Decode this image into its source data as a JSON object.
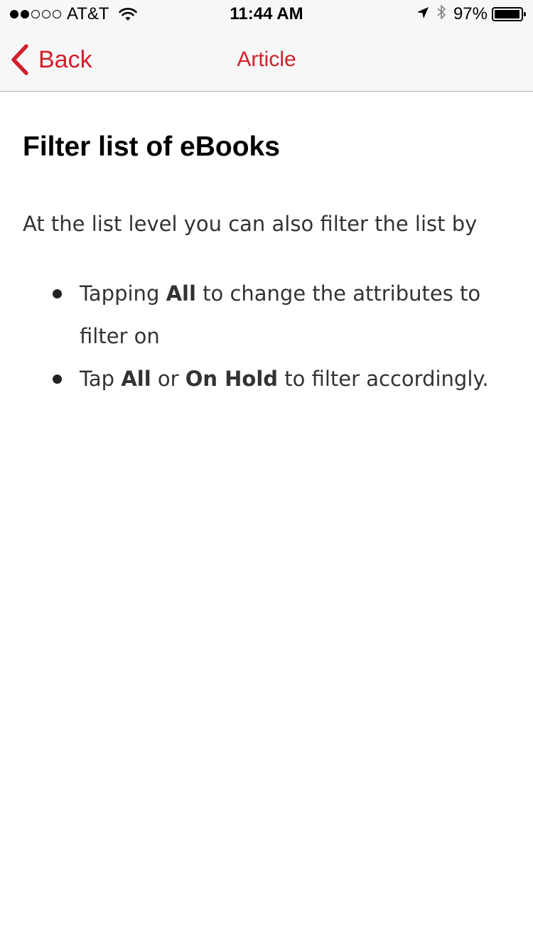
{
  "status_bar": {
    "carrier": "AT&T",
    "signal_bars_filled": 2,
    "signal_bars_total": 5,
    "time": "11:44 AM",
    "battery_percent": "97%",
    "battery_level": 0.97,
    "icons": [
      "wifi-icon",
      "location-icon",
      "bluetooth-icon",
      "battery-icon"
    ]
  },
  "nav": {
    "back_label": "Back",
    "title": "Article",
    "accent_color": "#d0202b"
  },
  "article": {
    "title": "Filter list of eBooks",
    "intro": "At the list level you can also filter the list by",
    "bullets": [
      {
        "part1": "Tapping ",
        "strong1": "All",
        "part2": " to change the attributes to filter on"
      },
      {
        "part1": "Tap ",
        "strong1": "All",
        "part2": " or ",
        "strong2": "On Hold",
        "part3": " to filter accordingly."
      }
    ]
  }
}
